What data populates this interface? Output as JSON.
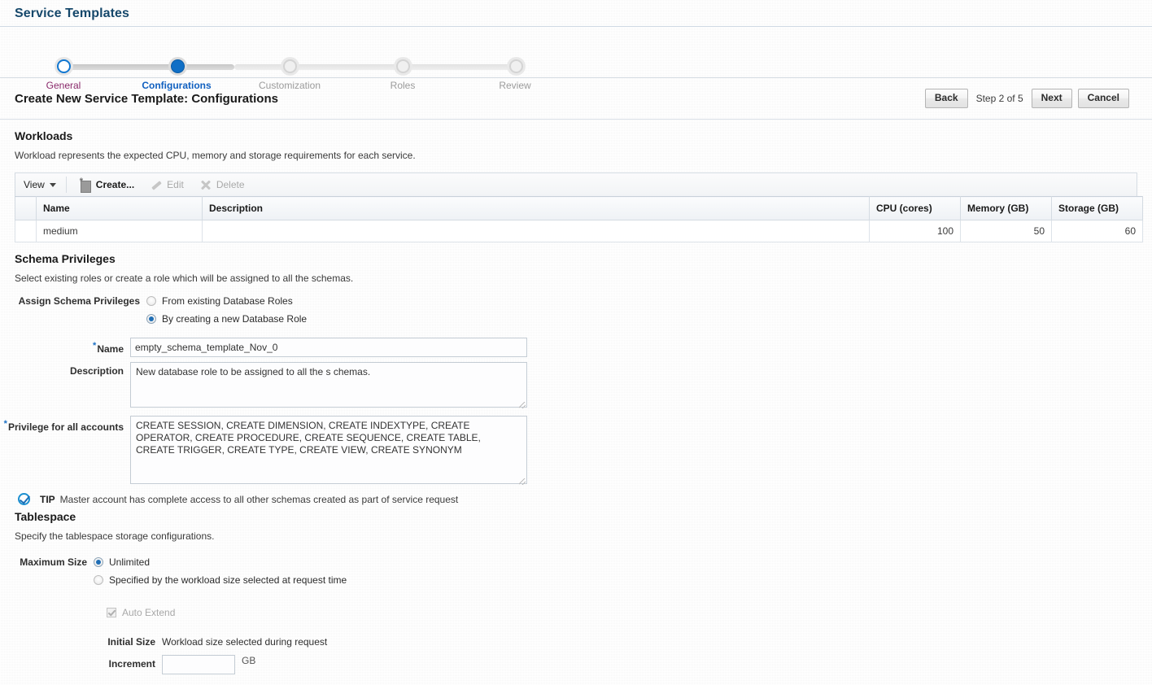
{
  "page": {
    "title": "Service Templates"
  },
  "train": {
    "steps": [
      {
        "label": "General",
        "state": "visited"
      },
      {
        "label": "Configurations",
        "state": "current"
      },
      {
        "label": "Customization",
        "state": "future"
      },
      {
        "label": "Roles",
        "state": "future"
      },
      {
        "label": "Review",
        "state": "future"
      }
    ]
  },
  "header": {
    "title": "Create New Service Template: Configurations",
    "back_label": "Back",
    "step_indicator": "Step 2 of 5",
    "next_label": "Next",
    "cancel_label": "Cancel"
  },
  "workloads": {
    "heading": "Workloads",
    "description": "Workload represents the expected CPU, memory and storage requirements for each service.",
    "toolbar": {
      "view_label": "View",
      "create_label": "Create...",
      "edit_label": "Edit",
      "delete_label": "Delete"
    },
    "columns": [
      "Name",
      "Description",
      "CPU (cores)",
      "Memory (GB)",
      "Storage (GB)"
    ],
    "rows": [
      {
        "name": "medium",
        "description": "",
        "cpu": "100",
        "memory": "50",
        "storage": "60"
      }
    ]
  },
  "schema_privileges": {
    "heading": "Schema Privileges",
    "description": "Select existing roles or create a role which will be assigned to all the schemas.",
    "assign_label": "Assign Schema Privileges",
    "option_existing": "From existing Database Roles",
    "option_new": "By creating a new Database Role",
    "selected_option": "new",
    "name_label": "Name",
    "name_value": "empty_schema_template_Nov_0",
    "description_label": "Description",
    "description_value": "New database role to be assigned to all the s chemas.",
    "privilege_label": "Privilege for all accounts",
    "privilege_value": "CREATE SESSION, CREATE DIMENSION, CREATE INDEXTYPE, CREATE OPERATOR, CREATE PROCEDURE, CREATE SEQUENCE, CREATE TABLE, CREATE TRIGGER, CREATE TYPE, CREATE VIEW, CREATE SYNONYM"
  },
  "tip": {
    "label": "TIP",
    "text": "Master account has complete access to all other schemas created as part of service request"
  },
  "tablespace": {
    "heading": "Tablespace",
    "description": "Specify the tablespace storage configurations.",
    "max_size_label": "Maximum Size",
    "option_unlimited": "Unlimited",
    "option_workload": "Specified by the workload size selected at request time",
    "selected_option": "unlimited",
    "auto_extend_label": "Auto Extend",
    "auto_extend_checked": true,
    "initial_size_label": "Initial Size",
    "initial_size_value": "Workload size selected during request",
    "increment_label": "Increment",
    "increment_value": "",
    "increment_unit": "GB"
  },
  "colors": {
    "title": "#16486b",
    "accent": "#0f6fc6",
    "visited": "#8a2a6b",
    "muted": "#9b9b9b"
  }
}
